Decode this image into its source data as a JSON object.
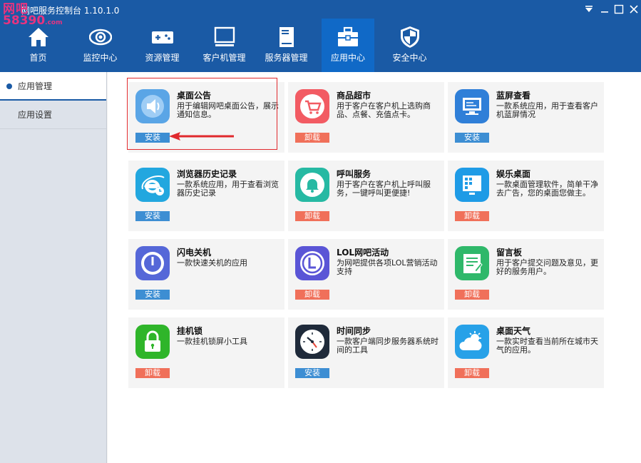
{
  "app": {
    "title": "网吧服务控制台 1.10.1.0"
  },
  "watermark": {
    "line1": "网吧",
    "line2": "58390",
    "suffix": ".com"
  },
  "colors": {
    "nav_bg": "#1a5aa5",
    "nav_active": "#1069c7",
    "install": "#3d8ed3",
    "uninstall": "#f0705a",
    "highlight": "#e0292d"
  },
  "nav": {
    "items": [
      {
        "label": "首页",
        "icon": "home-icon"
      },
      {
        "label": "监控中心",
        "icon": "eye-icon"
      },
      {
        "label": "资源管理",
        "icon": "gamepad-icon"
      },
      {
        "label": "客户机管理",
        "icon": "monitor-icon"
      },
      {
        "label": "服务器管理",
        "icon": "server-icon"
      },
      {
        "label": "应用中心",
        "icon": "toolbox-icon"
      },
      {
        "label": "安全中心",
        "icon": "shield-icon"
      }
    ],
    "active_index": 5
  },
  "sidebar": {
    "items": [
      {
        "label": "应用管理"
      },
      {
        "label": "应用设置"
      }
    ],
    "active_index": 0
  },
  "apps": [
    {
      "name": "桌面公告",
      "desc": "用于编辑网吧桌面公告，展示通知信息。",
      "button": "安装",
      "state": "install",
      "icon": "speaker-icon"
    },
    {
      "name": "商品超市",
      "desc": "用于客户在客户机上选购商品、点餐、充值点卡。",
      "button": "卸载",
      "state": "uninstall",
      "icon": "cart-icon"
    },
    {
      "name": "蓝屏查看",
      "desc": "一款系统应用，用于查看客户机蓝屏情况",
      "button": "安装",
      "state": "install",
      "icon": "bluescreen-icon"
    },
    {
      "name": "浏览器历史记录",
      "desc": "一款系统应用，用于查看浏览器历史记录",
      "button": "安装",
      "state": "install",
      "icon": "ie-history-icon"
    },
    {
      "name": "呼叫服务",
      "desc": "用于客户在客户机上呼叫服务，一键呼叫更便捷!",
      "button": "卸载",
      "state": "uninstall",
      "icon": "bell-icon"
    },
    {
      "name": "娱乐桌面",
      "desc": "一款桌面管理软件，简单干净去广告，您的桌面您做主。",
      "button": "卸载",
      "state": "uninstall",
      "icon": "desktop-grid-icon"
    },
    {
      "name": "闪电关机",
      "desc": "一款快速关机的应用",
      "button": "安装",
      "state": "install",
      "icon": "power-icon"
    },
    {
      "name": "LOL网吧活动",
      "desc": "为网吧提供各项LOL营销活动支持",
      "button": "卸载",
      "state": "uninstall",
      "icon": "lol-icon"
    },
    {
      "name": "留言板",
      "desc": "用于客户提交问题及意见，更好的服务用户。",
      "button": "卸载",
      "state": "uninstall",
      "icon": "notepad-icon"
    },
    {
      "name": "挂机锁",
      "desc": "一款挂机锁屏小工具",
      "button": "卸载",
      "state": "uninstall",
      "icon": "lock-icon"
    },
    {
      "name": "时间同步",
      "desc": "一款客户端同步服务器系统时间的工具",
      "button": "安装",
      "state": "install",
      "icon": "clock-icon"
    },
    {
      "name": "桌面天气",
      "desc": "一款实时查看当前所在城市天气的应用。",
      "button": "卸载",
      "state": "uninstall",
      "icon": "weather-icon"
    }
  ]
}
